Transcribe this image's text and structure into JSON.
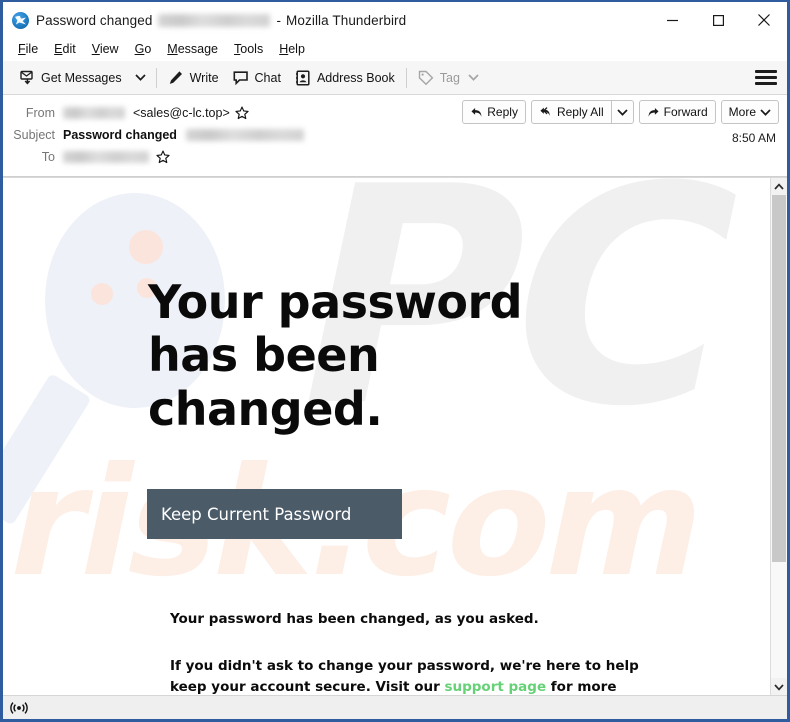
{
  "window": {
    "app_name": "Mozilla Thunderbird",
    "title_subject": "Password changed",
    "title_separator": "-",
    "icon": "thunderbird-icon",
    "controls": {
      "minimize": "minimize-icon",
      "maximize": "maximize-icon",
      "close": "close-icon"
    }
  },
  "menubar": {
    "items": [
      {
        "label": "File",
        "access_key": "F"
      },
      {
        "label": "Edit",
        "access_key": "E"
      },
      {
        "label": "View",
        "access_key": "V"
      },
      {
        "label": "Go",
        "access_key": "G"
      },
      {
        "label": "Message",
        "access_key": "M"
      },
      {
        "label": "Tools",
        "access_key": "T"
      },
      {
        "label": "Help",
        "access_key": "H"
      }
    ]
  },
  "toolbar": {
    "get_messages": "Get Messages",
    "get_messages_icon": "download-mail-icon",
    "get_messages_caret": "chevron-down-icon",
    "write": "Write",
    "write_icon": "pencil-icon",
    "chat": "Chat",
    "chat_icon": "speech-bubble-icon",
    "address_book": "Address Book",
    "address_book_icon": "address-book-icon",
    "tag": "Tag",
    "tag_icon": "tag-icon",
    "tag_caret": "chevron-down-icon",
    "tag_disabled": true,
    "app_menu_icon": "hamburger-menu-icon"
  },
  "message_header": {
    "from_label": "From",
    "from_name_redacted": true,
    "from_address": "<sales@c-lc.top>",
    "from_star_icon": "star-outline-icon",
    "subject_label": "Subject",
    "subject_text": "Password changed",
    "subject_redacted": true,
    "to_label": "To",
    "to_redacted": true,
    "to_star_icon": "star-outline-icon",
    "timestamp": "8:50 AM",
    "actions": {
      "reply": "Reply",
      "reply_icon": "reply-arrow-icon",
      "reply_all": "Reply All",
      "reply_all_icon": "reply-all-arrow-icon",
      "reply_all_caret": "chevron-down-icon",
      "forward": "Forward",
      "forward_icon": "forward-arrow-icon",
      "more": "More",
      "more_caret": "chevron-down-icon"
    }
  },
  "email": {
    "headline": "Your password has been changed.",
    "cta_button": "Keep Current Password",
    "paragraph_1": "Your password has been changed, as you asked.",
    "paragraph_2_before": "If you didn't ask to change your password, we're here to help keep your account secure. Visit our ",
    "paragraph_2_link": "support page",
    "paragraph_2_after": " for more info.",
    "watermark_pc": "PC",
    "watermark_risk": "risk.com"
  },
  "scrollbar": {
    "up_icon": "chevron-up-icon",
    "down_icon": "chevron-down-icon",
    "thumb_position_percent": 0
  },
  "statusbar": {
    "connection_icon": "broadcast-icon",
    "text": ""
  },
  "colors": {
    "window_border": "#2f5c9e",
    "cta_background": "#4b5b68",
    "link_green": "#66d177",
    "toolbar_background": "#f6f6f6",
    "statusbar_background": "#efefef"
  }
}
